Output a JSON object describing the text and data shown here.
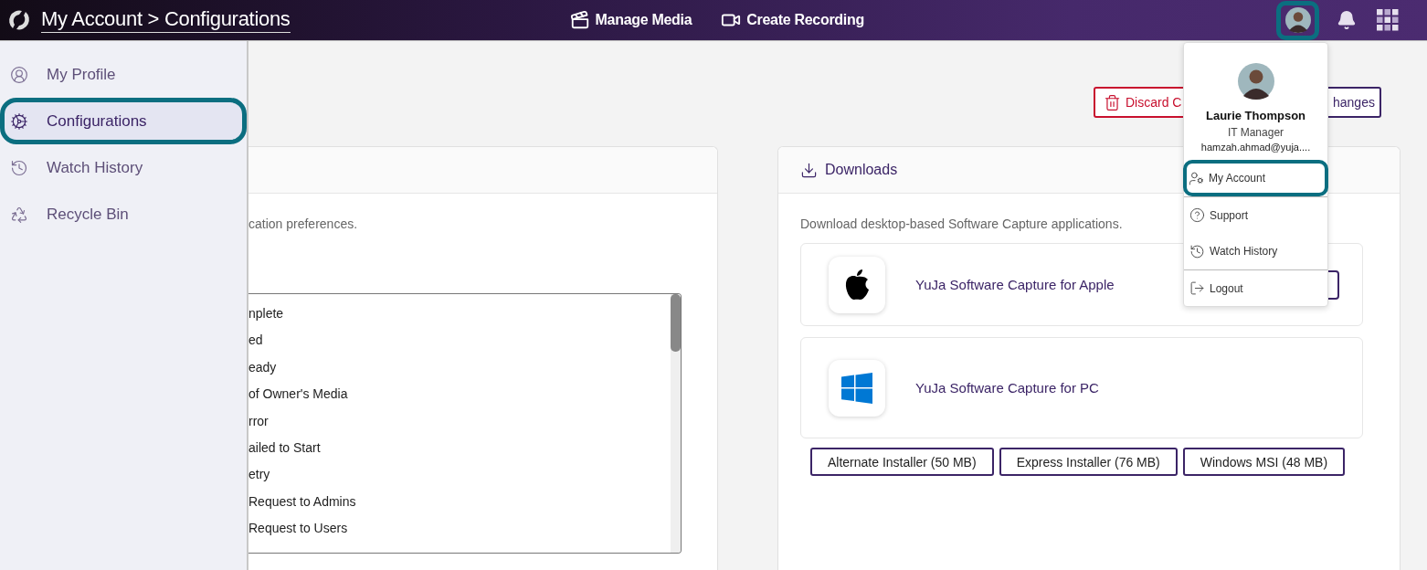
{
  "top_bar": {
    "breadcrumb": "My Account > Configurations",
    "nav": [
      {
        "label": "Manage Media",
        "kind": "media"
      },
      {
        "label": "Create Recording",
        "kind": "recording"
      }
    ],
    "avatar": {
      "highlighted": true
    }
  },
  "sidebar": {
    "items": [
      {
        "label": "My Profile",
        "kind": "profile",
        "selected": false,
        "highlighted": false
      },
      {
        "label": "Configurations",
        "kind": "settings",
        "selected": true,
        "highlighted": true
      },
      {
        "label": "Watch History",
        "kind": "history",
        "selected": false,
        "highlighted": false
      },
      {
        "label": "Recycle Bin",
        "kind": "recycle",
        "selected": false,
        "highlighted": false
      }
    ]
  },
  "actions": [
    {
      "label": "Discard C",
      "kind": "discard"
    },
    {
      "label": "hanges",
      "kind": "save"
    }
  ],
  "preferences_card": {
    "description": "cation preferences.",
    "options": [
      "nplete",
      "ed",
      "eady",
      "of Owner's Media",
      "rror",
      "ailed to Start",
      "etry",
      "Request to Admins",
      "Request to Users"
    ]
  },
  "downloads_card": {
    "title": "Downloads",
    "description": "Download desktop-based Software Capture applications.",
    "apps": [
      {
        "name": "YuJa Software Capture for Apple",
        "kind": "apple",
        "download_button": true
      },
      {
        "name": "YuJa Software Capture for PC",
        "kind": "windows",
        "download_button": false
      }
    ],
    "installers": [
      "Alternate Installer (50 MB)",
      "Express Installer (76 MB)",
      "Windows MSI (48 MB)"
    ]
  },
  "account_menu": {
    "name": "Laurie Thompson",
    "role": "IT Manager",
    "email": "hamzah.ahmad@yuja....",
    "items": [
      {
        "label": "My Account",
        "kind": "account",
        "highlighted": true,
        "divider_before": true
      },
      {
        "label": "Support",
        "kind": "support",
        "highlighted": false,
        "divider_before": true
      },
      {
        "label": "Watch History",
        "kind": "history",
        "highlighted": false,
        "divider_before": false
      },
      {
        "label": "Logout",
        "kind": "logout",
        "highlighted": false,
        "divider_before": true
      }
    ]
  }
}
